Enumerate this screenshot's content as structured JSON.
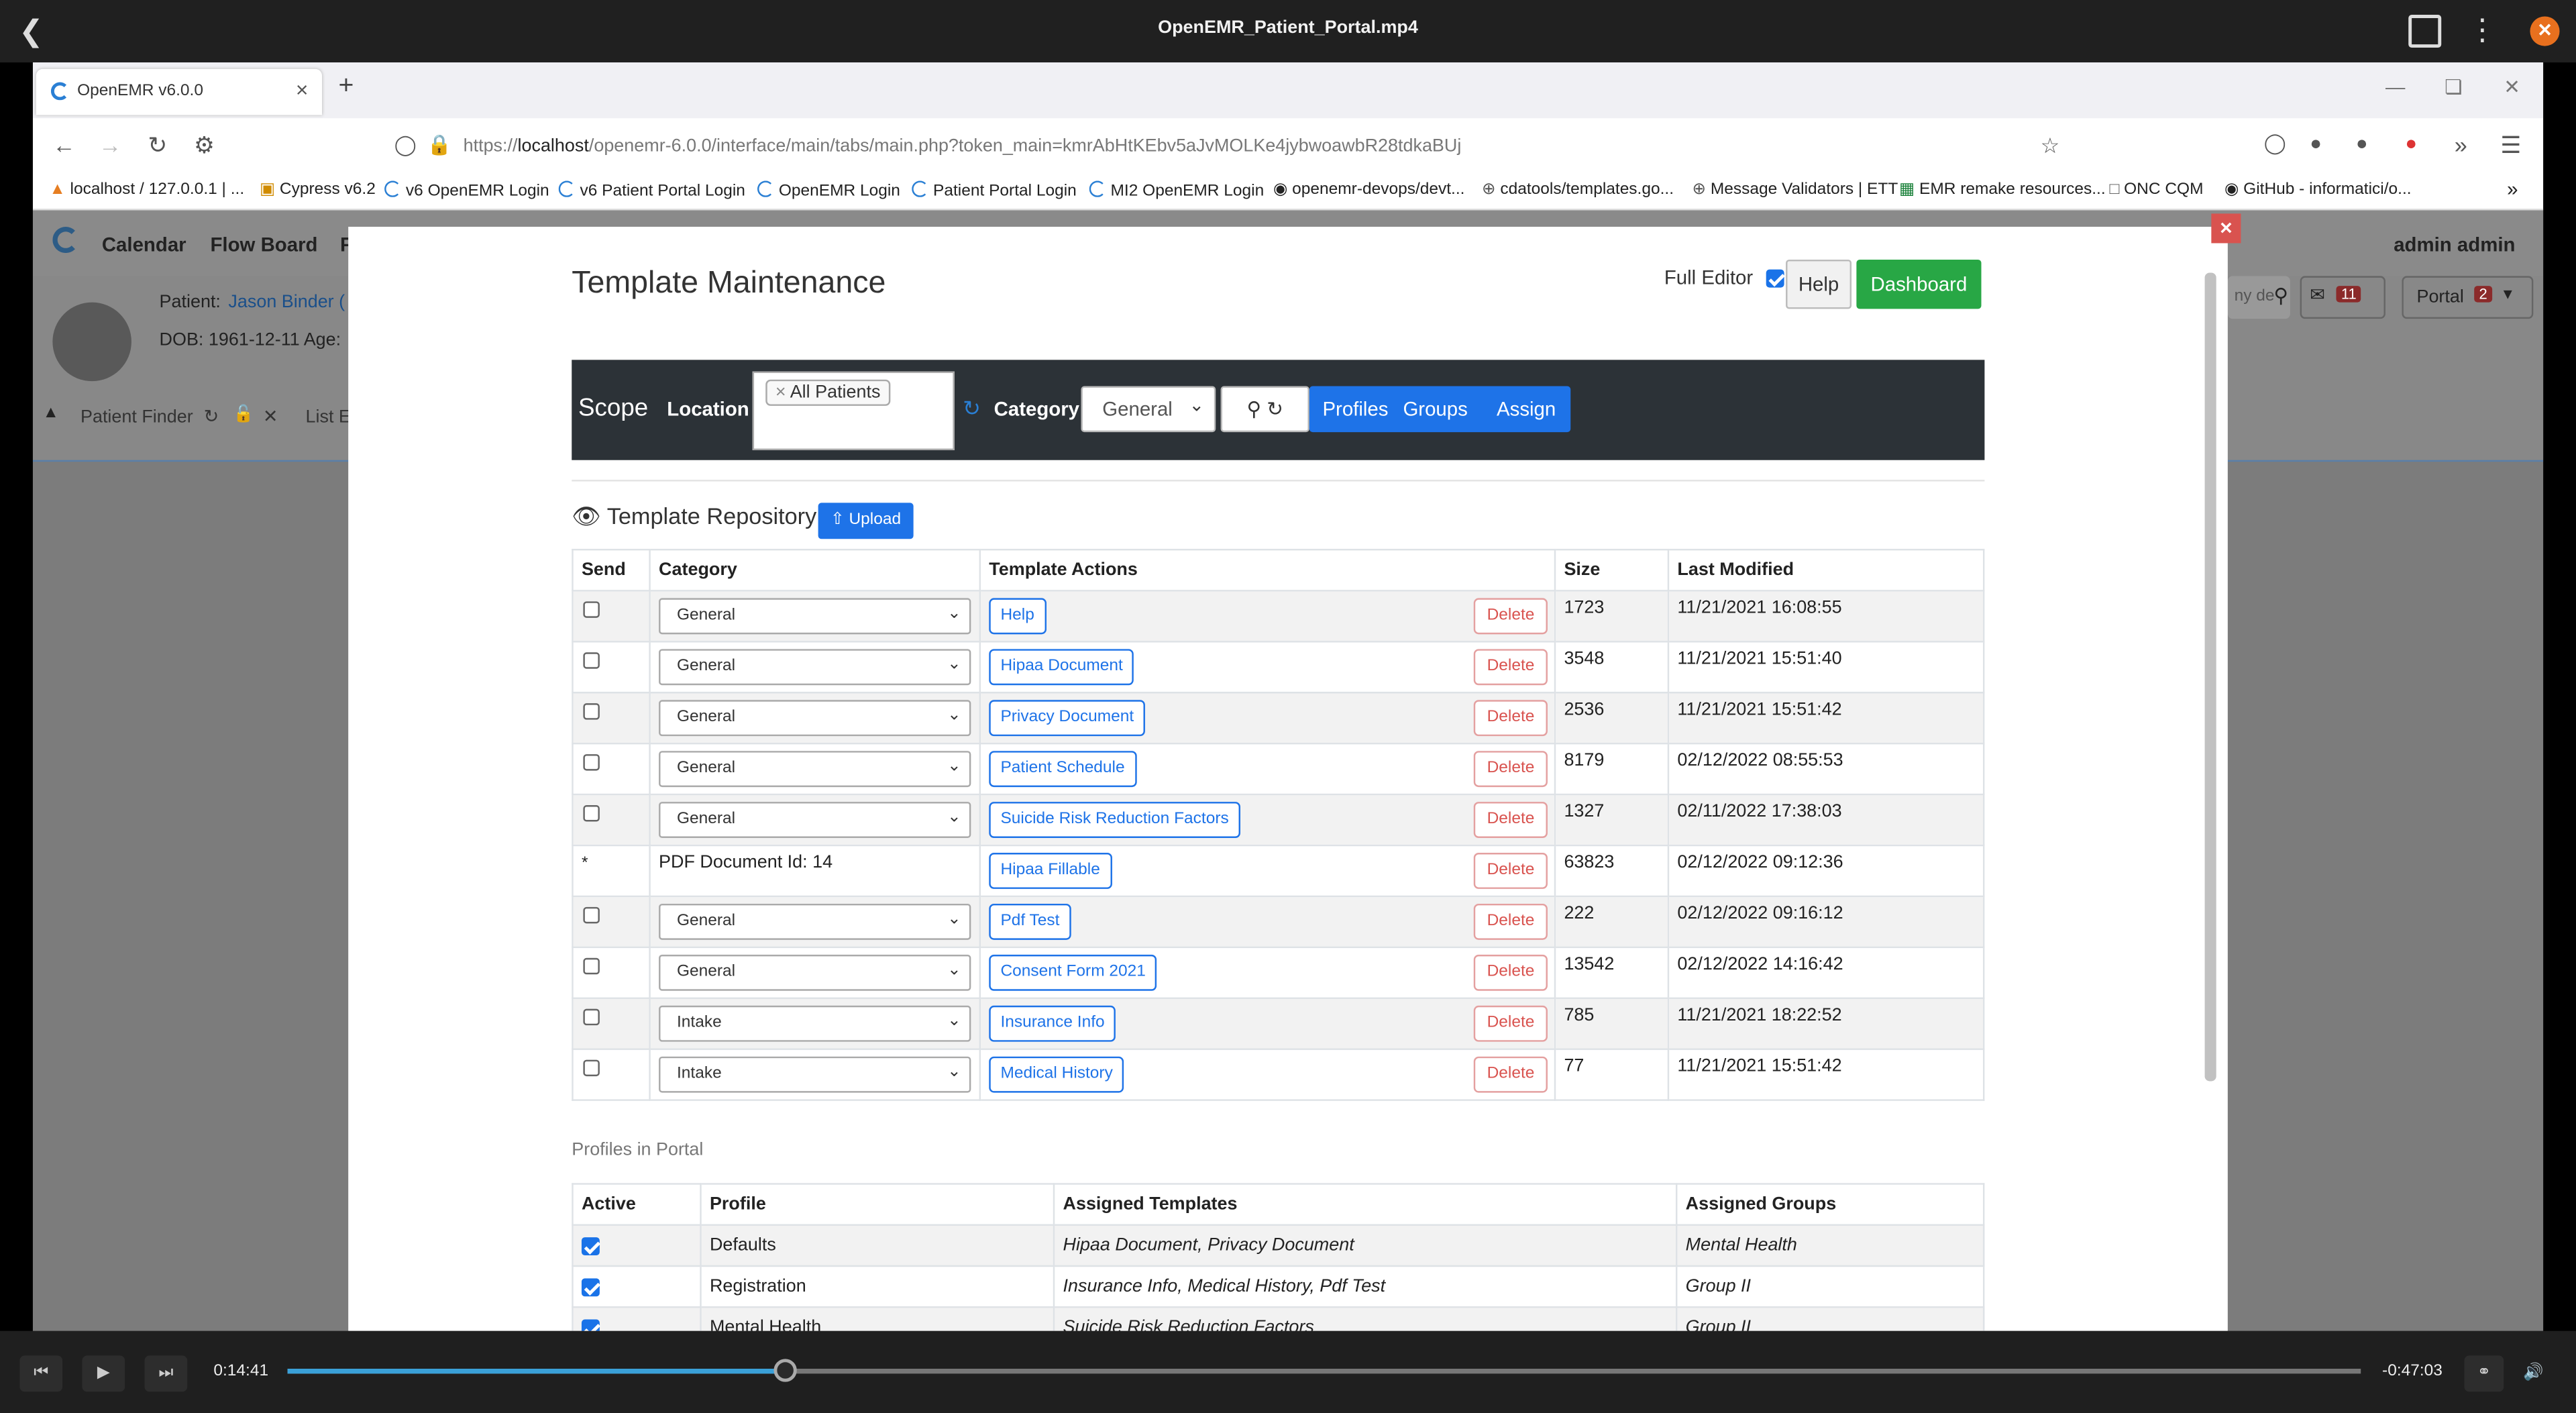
{
  "player": {
    "title": "OpenEMR_Patient_Portal.mp4",
    "time_elapsed": "0:14:41",
    "time_remaining": "-0:47:03",
    "progress": 0.24
  },
  "browser": {
    "tab_title": "OpenEMR v6.0.0",
    "url_prefix": "https://",
    "url_host": "localhost",
    "url_rest": "/openemr-6.0.0/interface/main/tabs/main.php?token_main=kmrAbHtKEbv5aJvMOLKe4jybwoawbR28tdkaBUj",
    "bookmarks": [
      "localhost / 127.0.0.1 | ...",
      "Cypress v6.2",
      "v6 OpenEMR Login",
      "v6 Patient Portal Login",
      "OpenEMR Login",
      "Patient Portal Login",
      "MI2 OpenEMR Login",
      "openemr-devops/devt...",
      "cdatools/templates.go...",
      "Message Validators | ETT",
      "EMR remake resources...",
      "ONC CQM",
      "GitHub - informatici/o..."
    ]
  },
  "emr": {
    "nav": [
      "Calendar",
      "Flow Board",
      "F"
    ],
    "user": "admin admin",
    "patient_label": "Patient:",
    "patient_name": "Jason Binder (",
    "dob": "DOB: 1961-12-11 Age:",
    "finder": "Patient Finder",
    "list": "List E",
    "portal": "Portal",
    "portal_badge": "2",
    "msg_badge": "11",
    "search_placeholder": "ny de"
  },
  "modal": {
    "title": "Template Maintenance",
    "full_editor_label": "Full Editor",
    "help": "Help",
    "dashboard": "Dashboard",
    "scope": "Scope",
    "location_label": "Location",
    "location_tag": "All Patients",
    "category_label": "Category",
    "category_value": "General",
    "profiles": "Profiles",
    "groups": "Groups",
    "assign": "Assign",
    "repo_title": "Template Repository",
    "upload": "Upload",
    "headers": {
      "send": "Send",
      "category": "Category",
      "actions": "Template Actions",
      "size": "Size",
      "modified": "Last Modified"
    },
    "delete_label": "Delete",
    "rows": [
      {
        "cat": "General",
        "name": "Help",
        "size": "1723",
        "date": "11/21/2021 16:08:55"
      },
      {
        "cat": "General",
        "name": "Hipaa Document",
        "size": "3548",
        "date": "11/21/2021 15:51:40"
      },
      {
        "cat": "General",
        "name": "Privacy Document",
        "size": "2536",
        "date": "11/21/2021 15:51:42"
      },
      {
        "cat": "General",
        "name": "Patient Schedule",
        "size": "8179",
        "date": "02/12/2022 08:55:53"
      },
      {
        "cat": "General",
        "name": "Suicide Risk Reduction Factors",
        "size": "1327",
        "date": "02/11/2022 17:38:03"
      },
      {
        "pdf": "PDF Document Id: 14",
        "name": "Hipaa Fillable",
        "size": "63823",
        "date": "02/12/2022 09:12:36"
      },
      {
        "cat": "General",
        "name": "Pdf Test",
        "size": "222",
        "date": "02/12/2022 09:16:12"
      },
      {
        "cat": "General",
        "name": "Consent Form 2021",
        "size": "13542",
        "date": "02/12/2022 14:16:42"
      },
      {
        "cat": "Intake",
        "name": "Insurance Info",
        "size": "785",
        "date": "11/21/2021 18:22:52"
      },
      {
        "cat": "Intake",
        "name": "Medical History",
        "size": "77",
        "date": "11/21/2021 15:51:42"
      }
    ],
    "profiles_label": "Profiles in Portal",
    "profile_headers": {
      "active": "Active",
      "profile": "Profile",
      "templates": "Assigned Templates",
      "groups": "Assigned Groups"
    },
    "profile_rows": [
      {
        "profile": "Defaults",
        "templates": "Hipaa Document, Privacy Document",
        "groups": "Mental Health"
      },
      {
        "profile": "Registration",
        "templates": "Insurance Info, Medical History, Pdf Test",
        "groups": "Group II"
      },
      {
        "profile": "Mental Health",
        "templates": "Suicide Risk Reduction Factors",
        "groups": "Group II"
      }
    ]
  }
}
